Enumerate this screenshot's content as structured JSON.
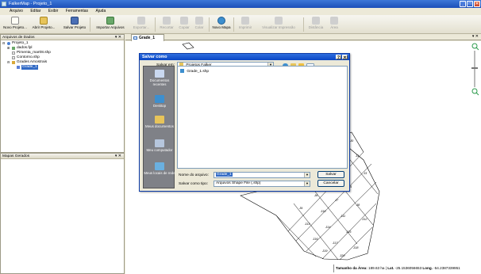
{
  "app": {
    "title": "FalkerMap - Projeto_1",
    "win_min": "_",
    "win_max": "□",
    "win_close": "✕"
  },
  "menu": [
    "Arquivo",
    "Editar",
    "Exibir",
    "Ferramentas",
    "Ajuda"
  ],
  "toolbar": {
    "novo_projeto": "Novo Projeto...",
    "abrir_projeto": "Abrir Projeto...",
    "salvar_projeto": "Salvar Projeto",
    "importar_arquivos": "Importar Arquivos",
    "exportar": "Exportar...",
    "recortar": "Recortar",
    "copiar": "Copiar",
    "colar": "Colar",
    "novo_mapa": "Novo Mapa",
    "imprimir": "Imprimir",
    "visualizar_impressao": "Visualizar Impressão",
    "distancia": "Distância",
    "area": "Área"
  },
  "left_panel": {
    "title": "Arquivos de Dados",
    "pin": "▾ ✕",
    "tree": [
      {
        "label": "Projeto_1"
      },
      {
        "label": "dados.fpl"
      },
      {
        "label": "Pimenta_mar08.shp"
      },
      {
        "label": "Contorno.shp"
      },
      {
        "label": "Grades Amostrais"
      },
      {
        "label": "Grade_1"
      }
    ]
  },
  "maps_panel": {
    "title": "Mapas Gerados",
    "pin": "▾ ✕"
  },
  "map_tab": {
    "label": "Grade_1",
    "close": "▾ ✕"
  },
  "grid_labels": [
    "J0",
    "J1",
    "J2",
    "J3",
    "J4",
    "J5",
    "J6",
    "J7",
    "J8",
    "J9",
    "J10",
    "J11",
    "J12",
    "J13",
    "J14",
    "J15",
    "J16",
    "J17",
    "J18",
    "J19",
    "J20"
  ],
  "status": {
    "area_label": "Tamanho da Área:",
    "area_value": "189.63 ha",
    "lat_label": "Lat.",
    "lat_value": "-25.1536056653",
    "lng_label": "Long.",
    "lng_value": "-54.2387339951"
  },
  "dialog": {
    "title": "Salvar como",
    "help": "?",
    "close": "✕",
    "save_in_label": "Salvar em:",
    "save_in_value": "Projetos Falker",
    "places": [
      "Documentos recentes",
      "Desktop",
      "Meus documentos",
      "Meu computador",
      "Meus locais de rede"
    ],
    "files": [
      "Grade_1.shp"
    ],
    "filename_label": "Nome do arquivo:",
    "filename_value": "Grade_1",
    "filetype_label": "Salvar como tipo:",
    "filetype_value": "Arquivos Shape File (.shp)",
    "save_button": "Salvar",
    "cancel_button": "Cancelar"
  }
}
